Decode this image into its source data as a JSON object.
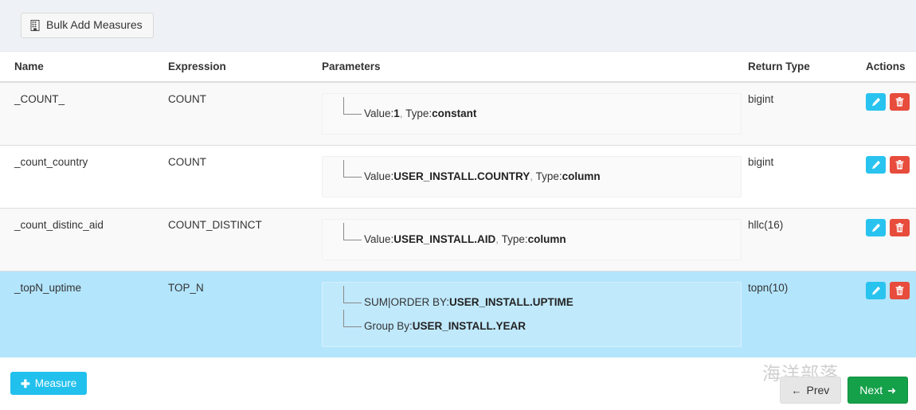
{
  "toolbar": {
    "bulk_add_label": "Bulk Add Measures",
    "bulk_add_icon": "book-icon"
  },
  "table": {
    "columns": [
      "Name",
      "Expression",
      "Parameters",
      "Return Type",
      "Actions"
    ],
    "rows": [
      {
        "name": "_COUNT_",
        "expression": "COUNT",
        "return_type": "bigint",
        "selected": false,
        "params": [
          {
            "label": "Value:",
            "value": "1",
            "sep": ", ",
            "label2": "Type:",
            "value2": "constant"
          }
        ]
      },
      {
        "name": "_count_country",
        "expression": "COUNT",
        "return_type": "bigint",
        "selected": false,
        "params": [
          {
            "label": "Value:",
            "value": "USER_INSTALL.COUNTRY",
            "sep": ", ",
            "label2": "Type:",
            "value2": "column"
          }
        ]
      },
      {
        "name": "_count_distinc_aid",
        "expression": "COUNT_DISTINCT",
        "return_type": "hllc(16)",
        "selected": false,
        "params": [
          {
            "label": "Value:",
            "value": "USER_INSTALL.AID",
            "sep": ", ",
            "label2": "Type:",
            "value2": "column"
          }
        ]
      },
      {
        "name": "_topN_uptime",
        "expression": "TOP_N",
        "return_type": "topn(10)",
        "selected": true,
        "params": [
          {
            "label": "SUM|ORDER BY:",
            "value": "USER_INSTALL.UPTIME",
            "sep": "",
            "label2": "",
            "value2": ""
          },
          {
            "label": "Group By:",
            "value": "USER_INSTALL.YEAR",
            "sep": "",
            "label2": "",
            "value2": ""
          }
        ]
      }
    ]
  },
  "footer": {
    "measure_label": "Measure",
    "measure_plus": "✚",
    "prev_label": "Prev",
    "next_label": "Next",
    "prev_arrow": "←",
    "next_arrow": "➜"
  },
  "watermark": "海洋部落",
  "colors": {
    "toolbar_bg": "#eef1f5",
    "row_selected": "#b3e5fc",
    "row_striped": "#f9f9f9",
    "edit_btn": "#29c3ef",
    "delete_btn": "#e74c3c",
    "measure_btn": "#22c0ed",
    "next_btn": "#15a04a",
    "prev_btn": "#e6e6e6"
  }
}
